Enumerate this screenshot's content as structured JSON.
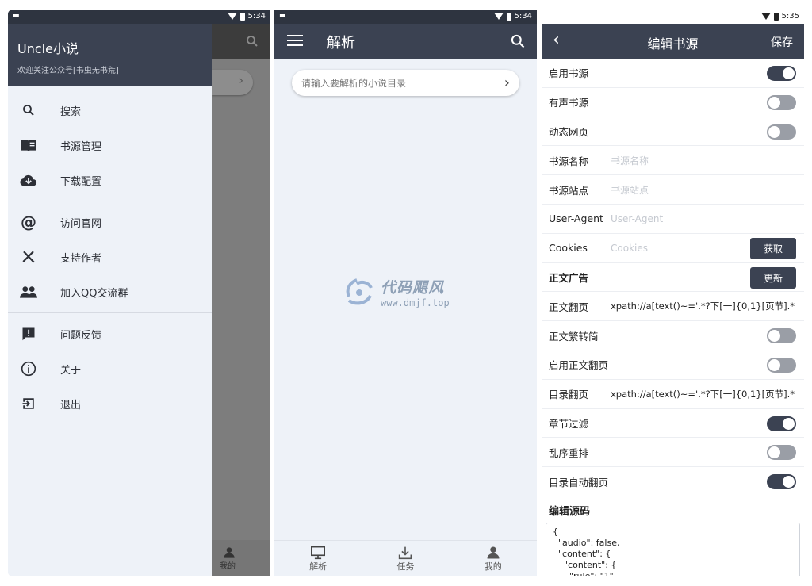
{
  "panel1": {
    "status": {
      "time": "5:34"
    },
    "drawer": {
      "title": "Uncle小说",
      "subtitle": "欢迎关注公众号[书虫无书荒]",
      "items": [
        {
          "label": "搜索",
          "icon": "search-icon"
        },
        {
          "label": "书源管理",
          "icon": "book-icon"
        },
        {
          "label": "下载配置",
          "icon": "cloud-download-icon"
        },
        {
          "label": "访问官网",
          "icon": "at-icon"
        },
        {
          "label": "支持作者",
          "icon": "cutlery-icon"
        },
        {
          "label": "加入QQ交流群",
          "icon": "group-icon"
        },
        {
          "label": "问题反馈",
          "icon": "feedback-icon"
        },
        {
          "label": "关于",
          "icon": "info-icon"
        },
        {
          "label": "退出",
          "icon": "exit-icon"
        }
      ]
    },
    "behind": {
      "nav_label": "我的"
    }
  },
  "panel2": {
    "status": {
      "time": "5:34"
    },
    "title": "解析",
    "search": {
      "placeholder": "请输入要解析的小说目录",
      "value": ""
    },
    "watermark": {
      "name": "代码飓风",
      "url": "www.dmjf.top"
    },
    "nav": [
      {
        "label": "解析",
        "icon": "monitor-icon"
      },
      {
        "label": "任务",
        "icon": "download-tray-icon"
      },
      {
        "label": "我的",
        "icon": "person-icon"
      }
    ]
  },
  "panel3": {
    "status": {
      "time": "5:35"
    },
    "title": "编辑书源",
    "save": "保存",
    "rows": {
      "enable_source": {
        "label": "启用书源",
        "on": true
      },
      "audio_source": {
        "label": "有声书源",
        "on": false
      },
      "dynamic_page": {
        "label": "动态网页",
        "on": false
      },
      "source_name": {
        "label": "书源名称",
        "placeholder": "书源名称"
      },
      "source_site": {
        "label": "书源站点",
        "placeholder": "书源站点"
      },
      "user_agent": {
        "label": "User-Agent",
        "placeholder": "User-Agent"
      },
      "cookies": {
        "label": "Cookies",
        "placeholder": "Cookies",
        "button": "获取"
      },
      "content_ad": {
        "label": "正文广告",
        "button": "更新"
      },
      "content_page": {
        "label": "正文翻页",
        "value": "xpath://a[text()~='.*?下[一]{0,1}[页节].*"
      },
      "content_trad": {
        "label": "正文繁转简",
        "on": false
      },
      "enable_content_page": {
        "label": "启用正文翻页",
        "on": false
      },
      "toc_page": {
        "label": "目录翻页",
        "value": "xpath://a[text()~='.*?下[一]{0,1}[页节].*"
      },
      "chapter_filter": {
        "label": "章节过滤",
        "on": true
      },
      "shuffle_sort": {
        "label": "乱序重排",
        "on": false
      },
      "toc_auto_page": {
        "label": "目录自动翻页",
        "on": true
      }
    },
    "source_editor": {
      "label": "编辑源码",
      "code": "{\n  \"audio\": false,\n  \"content\": {\n    \"content\": {\n      \"rule\": \"1\""
    }
  }
}
